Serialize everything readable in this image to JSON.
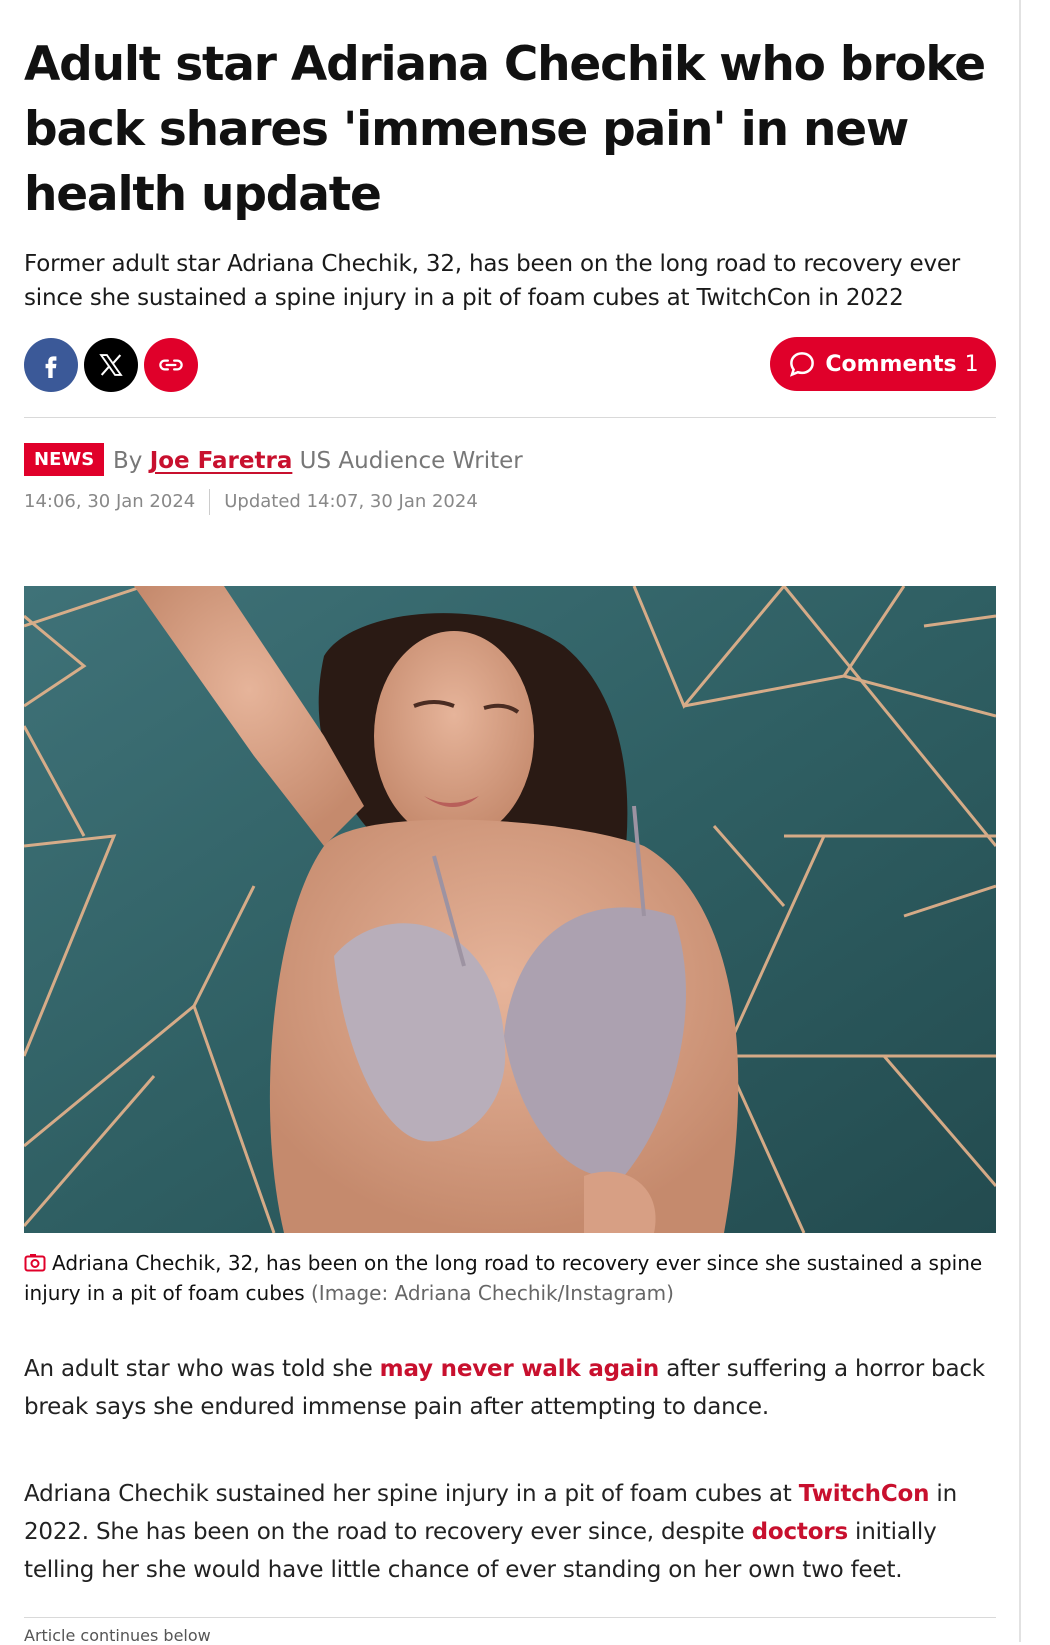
{
  "article": {
    "headline": "Adult star Adriana Chechik who broke back shares 'immense pain' in new health update",
    "standfirst": "Former adult star Adriana Chechik, 32, has been on the long road to recovery ever since she sustained a spine injury in a pit of foam cubes at TwitchCon in 2022",
    "section_tag": "NEWS",
    "byline_prefix": "By",
    "author": "Joe Faretra",
    "author_role": "US Audience Writer",
    "published": "14:06, 30 Jan 2024",
    "updated": "Updated 14:07, 30 Jan 2024"
  },
  "share": {
    "facebook_icon": "facebook-icon",
    "x_icon": "x-icon",
    "link_icon": "link-icon"
  },
  "comments": {
    "label": "Comments",
    "count": "1"
  },
  "image": {
    "caption": "Adriana Chechik, 32, has been on the long road to recovery ever since she sustained a spine injury in a pit of foam cubes",
    "credit": "(Image: Adriana Chechik/Instagram)"
  },
  "body": {
    "p1_a": "An adult star who was told she ",
    "p1_link": "may never walk again",
    "p1_b": " after suffering a horror back break says she endured immense pain after attempting to dance.",
    "p2_a": "Adriana Chechik sustained her spine injury in a pit of foam cubes at ",
    "p2_link1": "TwitchCon",
    "p2_b": " in 2022. She has been on the road to recovery ever since, despite ",
    "p2_link2": "doctors",
    "p2_c": " initially telling her she would have little chance of ever standing on her own two feet."
  },
  "footer": {
    "continues": "Article continues below"
  },
  "colors": {
    "brand_red": "#e0002a",
    "link_red": "#c8102e",
    "facebook_blue": "#3b5998"
  }
}
